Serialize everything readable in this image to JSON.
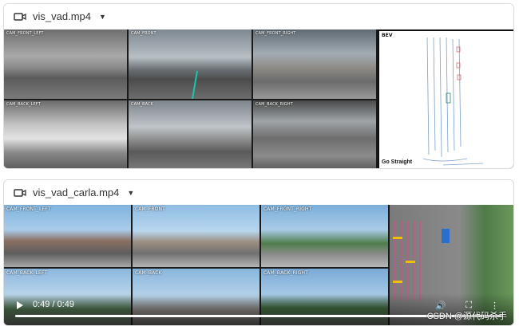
{
  "videos": [
    {
      "filename": "vis_vad.mp4",
      "views": [
        "CAM_FRONT_LEFT",
        "CAM_FRONT",
        "CAM_FRONT_RIGHT",
        "CAM_BACK_LEFT",
        "CAM_BACK",
        "CAM_BACK_RIGHT"
      ],
      "bev_label": "BEV",
      "bev_command": "Go Straight"
    },
    {
      "filename": "vis_vad_carla.mp4",
      "views": [
        "CAM_FRONT_LEFT",
        "CAM_FRONT",
        "CAM_FRONT_RIGHT",
        "CAM_BACK_LEFT",
        "CAM_BACK",
        "CAM_BACK_RIGHT"
      ],
      "time": "0:49 / 0:49",
      "progress": 1.0
    }
  ],
  "watermark": "CSDN @源代码杀手",
  "icons": {
    "video": "video-camera-icon",
    "menu": "chevron-down-icon",
    "play": "play-icon",
    "volume": "volume-icon",
    "fullscreen": "fullscreen-icon",
    "more": "more-vert-icon"
  }
}
